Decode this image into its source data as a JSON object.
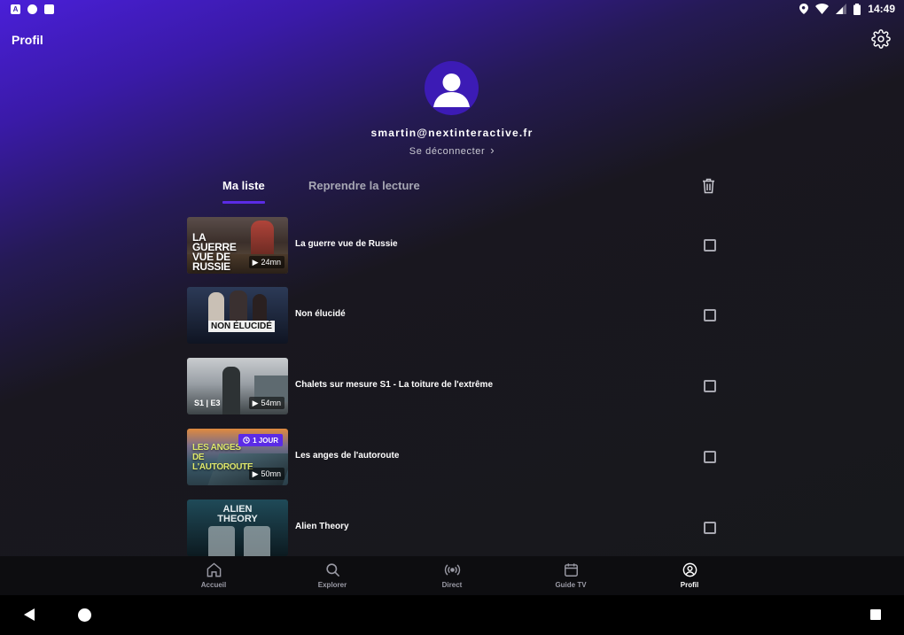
{
  "status_bar": {
    "time": "14:49",
    "left_icons": [
      "notification-a-icon",
      "notification-circle-icon",
      "sd-card-icon"
    ],
    "right_icons": [
      "location-icon",
      "wifi-icon",
      "signal-icon",
      "battery-icon"
    ]
  },
  "header": {
    "title": "Profil",
    "settings_icon": "gear-icon"
  },
  "profile": {
    "email": "smartin@nextinteractive.fr",
    "logout_label": "Se déconnecter",
    "accent_color": "#3c1bb5"
  },
  "tabs": [
    {
      "label": "Ma liste",
      "active": true
    },
    {
      "label": "Reprendre la lecture",
      "active": false
    }
  ],
  "list": [
    {
      "title": "La guerre vue de Russie",
      "thumb_text": "La guerre vue de Russie",
      "duration": "24mn",
      "episode": "",
      "badge": "",
      "checked": false
    },
    {
      "title": "Non élucidé",
      "thumb_text": "Non élucidé",
      "duration": "",
      "episode": "",
      "badge": "",
      "checked": false
    },
    {
      "title": "Chalets sur mesure S1 - La toiture de l'extrême",
      "thumb_text": "",
      "duration": "54mn",
      "episode": "S1 | E3",
      "badge": "",
      "checked": false
    },
    {
      "title": "Les anges de l'autoroute",
      "thumb_text": "Les anges de l'autoroute",
      "duration": "50mn",
      "episode": "",
      "badge": "1 JOUR",
      "checked": false
    },
    {
      "title": "Alien Theory",
      "thumb_text": "Alien Theory",
      "duration": "",
      "episode": "",
      "badge": "",
      "checked": false
    }
  ],
  "bottom_nav": [
    {
      "label": "Accueil",
      "icon": "home-icon",
      "active": false
    },
    {
      "label": "Explorer",
      "icon": "search-icon",
      "active": false
    },
    {
      "label": "Direct",
      "icon": "broadcast-icon",
      "active": false
    },
    {
      "label": "Guide TV",
      "icon": "calendar-icon",
      "active": false
    },
    {
      "label": "Profil",
      "icon": "profile-icon",
      "active": true
    }
  ],
  "colors": {
    "accent": "#5b2be6",
    "background": "#17181c"
  }
}
